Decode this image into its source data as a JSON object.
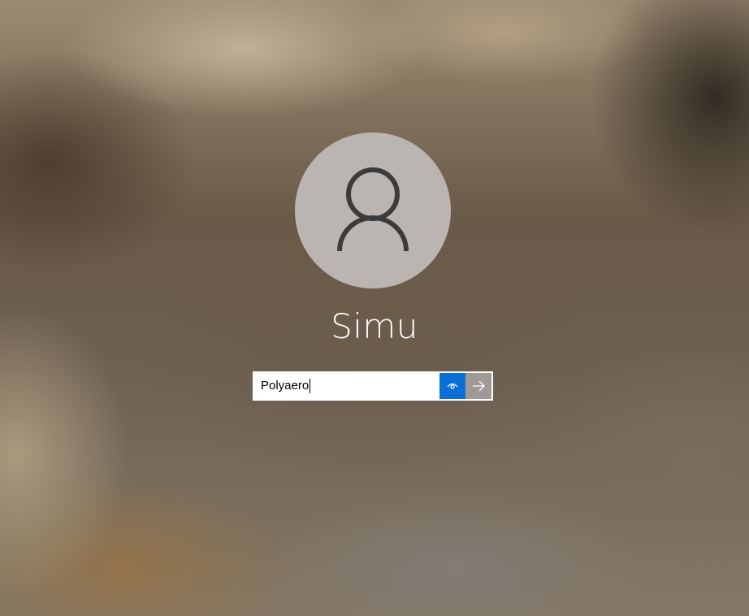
{
  "user": {
    "name": "Simu"
  },
  "password_field": {
    "value": "Polyaero"
  },
  "icons": {
    "avatar": "person-icon",
    "reveal": "eye-icon",
    "submit": "arrow-right-icon"
  },
  "colors": {
    "reveal_button": "#0a6fd6",
    "submit_button": "#9f9a96",
    "avatar_circle": "#bab5b0",
    "username_text": "#ffffff"
  }
}
